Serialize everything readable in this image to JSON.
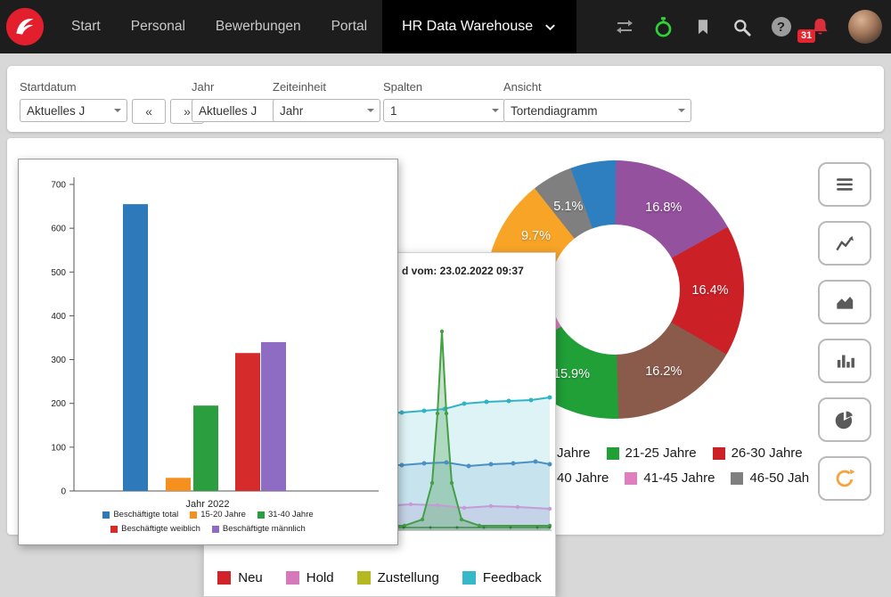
{
  "nav": {
    "items": [
      "Start",
      "Personal",
      "Bewerbungen",
      "Portal"
    ],
    "active": "HR Data Warehouse",
    "badge": "31"
  },
  "icons": {
    "question": "?",
    "prev": "«",
    "next": "»"
  },
  "filters": {
    "startdatum_label": "Startdatum",
    "startdatum_value": "Aktuelles J",
    "jahr_label": "Jahr",
    "jahr_value": "Aktuelles J",
    "zeiteinheit_label": "Zeiteinheit",
    "zeiteinheit_value": "Jahr",
    "spalten_label": "Spalten",
    "spalten_value": "1",
    "ansicht_label": "Ansicht",
    "ansicht_value": "Tortendiagramm"
  },
  "toolbar": {
    "buttons": [
      "menu",
      "line-chart",
      "area-chart",
      "bar-chart",
      "pie-chart",
      "refresh"
    ],
    "refresh_color": "#f5a33c"
  },
  "chart_data": [
    {
      "id": "employees-bar-chart",
      "type": "bar",
      "xlabel": "Jahr 2022",
      "ylabel": "",
      "ylim": [
        0,
        700
      ],
      "yticks": [
        0,
        100,
        200,
        300,
        400,
        500,
        600,
        700
      ],
      "series": [
        {
          "name": "Beschäftigte total",
          "value": 655,
          "color": "#2e79b9"
        },
        {
          "name": "15-20 Jahre",
          "value": 30,
          "color": "#f5901e"
        },
        {
          "name": "31-40 Jahre",
          "value": 195,
          "color": "#2b9e3f"
        },
        {
          "name": "Beschäftigte weiblich",
          "value": 315,
          "color": "#d62b2b"
        },
        {
          "name": "Beschäftigte männlich",
          "value": 340,
          "color": "#8e6cc3"
        }
      ],
      "legend_rows": [
        [
          0,
          1,
          2
        ],
        [
          3,
          4
        ]
      ]
    },
    {
      "id": "age-distribution-donut",
      "type": "pie",
      "start_angle_deg": 340,
      "segments": [
        {
          "value": 5.7,
          "color": "#2d7fc0",
          "label": ""
        },
        {
          "value": 16.8,
          "color": "#93519e",
          "label": "16.8%"
        },
        {
          "value": 16.4,
          "color": "#cc2027",
          "label": "16.4%"
        },
        {
          "value": 16.2,
          "color": "#8a5a4b",
          "label": "16.2%"
        },
        {
          "value": 15.9,
          "color": "#21a038",
          "label": "15.9%"
        },
        {
          "value": 14.2,
          "color": "#df7fbe",
          "label": ""
        },
        {
          "value": 9.7,
          "color": "#f7a427",
          "label": "9.7%"
        },
        {
          "value": 5.1,
          "color": "#7f7f7f",
          "label": "5.1%"
        }
      ],
      "legend_rows": [
        [
          {
            "label": "Jahre"
          },
          {
            "label": "21-25 Jahre",
            "color": "#21a038"
          },
          {
            "label": "26-30 Jahre",
            "color": "#cc2027"
          }
        ],
        [
          {
            "label": "40 Jahre"
          },
          {
            "label": "41-45 Jahre",
            "color": "#df7fbe"
          },
          {
            "label": "46-50 Jah",
            "color": "#7f7f7f"
          }
        ]
      ]
    },
    {
      "id": "timeline-area-chart",
      "type": "area",
      "title_visible": "d vom: 23.02.2022 09:37",
      "units": "panel-px",
      "baseline_y": 311,
      "series": [
        {
          "name": "feedback-line",
          "color": "#2fb3c7",
          "fill": "rgba(47,179,199,0.16)",
          "dots": true,
          "dot_r": 2.5,
          "width": 2,
          "points": [
            [
              14,
              181
            ],
            [
              60,
              180
            ],
            [
              106,
              181
            ],
            [
              152,
              180
            ],
            [
              198,
              180
            ],
            [
              222,
              179
            ],
            [
              247,
              177
            ],
            [
              270,
              175
            ],
            [
              292,
              169
            ],
            [
              317,
              167
            ],
            [
              342,
              166
            ],
            [
              367,
              165
            ],
            [
              388,
              162
            ]
          ]
        },
        {
          "name": "blue-line",
          "color": "#4a90c4",
          "fill": "rgba(74,144,196,0.16)",
          "dots": true,
          "dot_r": 2.5,
          "width": 2,
          "points": [
            [
              14,
              237
            ],
            [
              60,
              238
            ],
            [
              106,
              236
            ],
            [
              152,
              238
            ],
            [
              198,
              238
            ],
            [
              222,
              238
            ],
            [
              247,
              236
            ],
            [
              272,
              235
            ],
            [
              297,
              239
            ],
            [
              322,
              237
            ],
            [
              347,
              236
            ],
            [
              372,
              234
            ],
            [
              388,
              237
            ]
          ]
        },
        {
          "name": "lavender-line",
          "color": "#c49bd6",
          "fill": "rgba(196,155,214,0.22)",
          "dots": true,
          "dot_r": 2.2,
          "width": 2,
          "points": [
            [
              14,
              284
            ],
            [
              60,
              285
            ],
            [
              106,
              283
            ],
            [
              152,
              285
            ],
            [
              198,
              284
            ],
            [
              232,
              282
            ],
            [
              262,
              283
            ],
            [
              292,
              286
            ],
            [
              322,
              284
            ],
            [
              352,
              285
            ],
            [
              388,
              287
            ]
          ]
        },
        {
          "name": "green-peak-line",
          "color": "#43a047",
          "fill": "rgba(67,160,71,0.30)",
          "dots": true,
          "dot_r": 2.2,
          "width": 2,
          "points": [
            [
              14,
              306
            ],
            [
              225,
              306
            ],
            [
              245,
              299
            ],
            [
              256,
              258
            ],
            [
              262,
              180
            ],
            [
              267,
              88
            ],
            [
              272,
              180
            ],
            [
              278,
              258
            ],
            [
              289,
              299
            ],
            [
              309,
              306
            ],
            [
              388,
              306
            ]
          ]
        },
        {
          "name": "bottom-green-line",
          "color": "#2e7d32",
          "fill": null,
          "dots": true,
          "dot_r": 1.5,
          "width": 1.3,
          "points": [
            [
              14,
              308
            ],
            [
              44,
              308
            ],
            [
              74,
              308
            ],
            [
              104,
              308
            ],
            [
              134,
              308
            ],
            [
              164,
              308
            ],
            [
              194,
              308
            ],
            [
              224,
              308
            ],
            [
              254,
              308
            ],
            [
              284,
              308
            ],
            [
              314,
              308
            ],
            [
              344,
              308
            ],
            [
              374,
              308
            ],
            [
              388,
              308
            ]
          ]
        }
      ],
      "legend": [
        {
          "label": "Neu",
          "color": "#d2232a"
        },
        {
          "label": "Hold",
          "color": "#d678bc"
        },
        {
          "label": "Zustellung",
          "color": "#b5b821"
        },
        {
          "label": "Feedback",
          "color": "#35b8c8"
        }
      ]
    }
  ]
}
